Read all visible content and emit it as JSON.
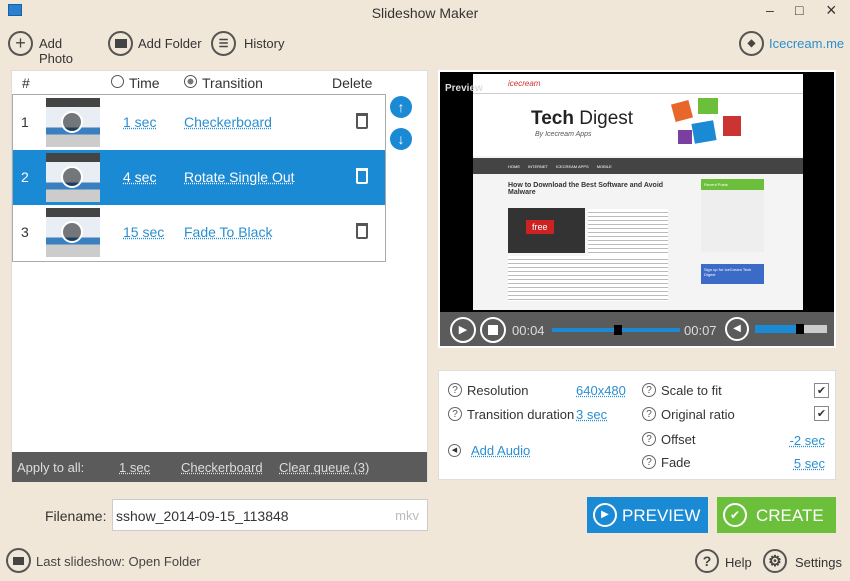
{
  "window": {
    "title": "Slideshow Maker",
    "minimize": "–",
    "maximize": "□",
    "close": "×"
  },
  "toolbar": {
    "add_photo": "Add Photo",
    "add_folder": "Add Folder",
    "history": "History",
    "brand_link": "Icecream.me"
  },
  "list": {
    "headers": {
      "num": "#",
      "time": "Time",
      "transition": "Transition",
      "delete": "Delete"
    },
    "rows": [
      {
        "num": "1",
        "time": "1 sec",
        "transition": "Checkerboard"
      },
      {
        "num": "2",
        "time": "4 sec",
        "transition": "Rotate Single Out",
        "selected": true
      },
      {
        "num": "3",
        "time": "15 sec",
        "transition": "Fade To Black"
      }
    ],
    "apply_label": "Apply to all:",
    "apply_time": "1 sec",
    "apply_transition": "Checkerboard",
    "clear_queue": "Clear queue (3)"
  },
  "filename": {
    "label": "Filename:",
    "value": "sshow_2014-09-15_113848",
    "extension": "mkv"
  },
  "last_slideshow": "Last slideshow: Open Folder",
  "preview": {
    "label": "Preview",
    "page_title_bold": "Tech",
    "page_title": "Digest",
    "page_sub": "By Icecream Apps",
    "article_title": "How to Download the Best Software and Avoid Malware",
    "nav": [
      "HOME",
      "INTERNET",
      "ICECREAM APPS",
      "MOBILE"
    ],
    "sidebar_head": "Recent Posts",
    "signup": "Sign up for IceCream Tech Digest",
    "key_label": "free",
    "current_time": "00:04",
    "total_time": "00:07",
    "progress": 0.4,
    "volume": 0.6
  },
  "settings": {
    "resolution_label": "Resolution",
    "resolution": "640x480",
    "transition_duration_label": "Transition duration",
    "transition_duration": "3 sec",
    "add_audio": "Add Audio",
    "scale_label": "Scale to fit",
    "scale": true,
    "ratio_label": "Original ratio",
    "ratio": true,
    "offset_label": "Offset",
    "offset": "-2 sec",
    "fade_label": "Fade",
    "fade": "5 sec"
  },
  "buttons": {
    "preview": "PREVIEW",
    "create": "CREATE",
    "help": "Help",
    "settings": "Settings"
  },
  "colors": {
    "accent": "#1b8ad4",
    "create": "#6cbf3a",
    "background": "#f1e7d8"
  }
}
